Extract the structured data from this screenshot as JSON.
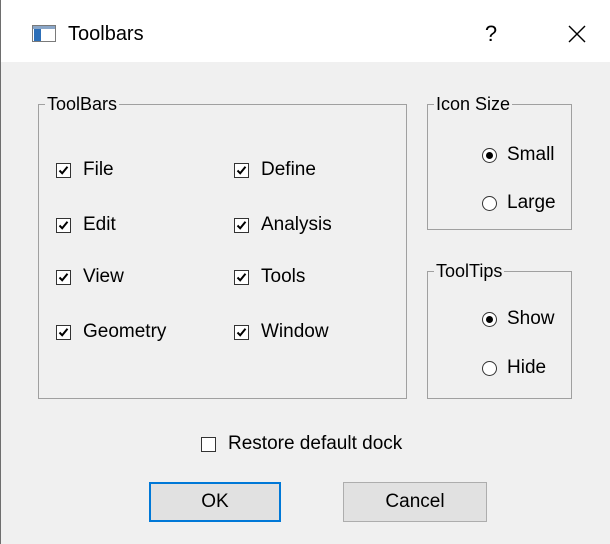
{
  "window": {
    "title": "Toolbars",
    "help_label": "?",
    "close_icon": "close-icon"
  },
  "toolbars_group": {
    "label": "ToolBars",
    "items": [
      {
        "label": "File",
        "checked": true
      },
      {
        "label": "Define",
        "checked": true
      },
      {
        "label": "Edit",
        "checked": true
      },
      {
        "label": "Analysis",
        "checked": true
      },
      {
        "label": "View",
        "checked": true
      },
      {
        "label": "Tools",
        "checked": true
      },
      {
        "label": "Geometry",
        "checked": true
      },
      {
        "label": "Window",
        "checked": true
      }
    ]
  },
  "icon_size_group": {
    "label": "Icon Size",
    "options": [
      {
        "label": "Small",
        "selected": true
      },
      {
        "label": "Large",
        "selected": false
      }
    ]
  },
  "tooltips_group": {
    "label": "ToolTips",
    "options": [
      {
        "label": "Show",
        "selected": true
      },
      {
        "label": "Hide",
        "selected": false
      }
    ]
  },
  "restore_default_dock": {
    "label": "Restore default dock",
    "checked": false
  },
  "buttons": {
    "ok": "OK",
    "cancel": "Cancel"
  },
  "colors": {
    "dialog_bg": "#f0f0f0",
    "default_button_border": "#0078d7",
    "button_bg": "#e1e1e1"
  }
}
